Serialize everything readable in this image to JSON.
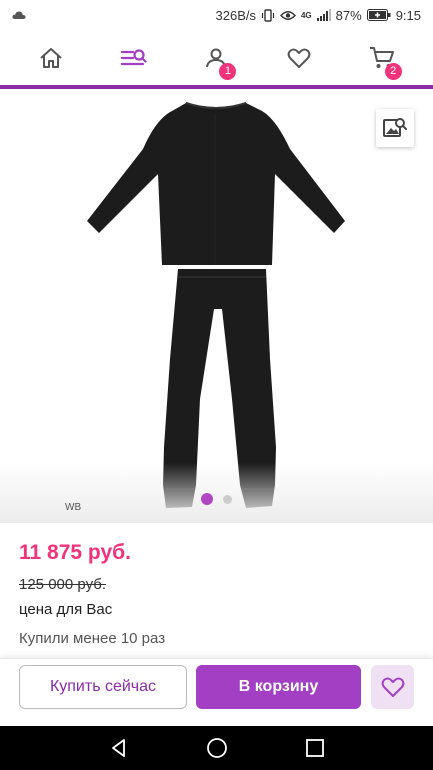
{
  "status_bar": {
    "speed": "326B/s",
    "battery": "87%",
    "time": "9:15",
    "network": "4G",
    "icons": [
      "cloud-icon",
      "vibrate-icon",
      "eye-icon",
      "signal-icon",
      "battery-icon"
    ]
  },
  "nav": {
    "items": [
      {
        "name": "home",
        "icon": "home-icon"
      },
      {
        "name": "catalog",
        "icon": "catalog-search-icon"
      },
      {
        "name": "profile",
        "icon": "user-icon",
        "badge": "1"
      },
      {
        "name": "favorites",
        "icon": "heart-icon"
      },
      {
        "name": "cart",
        "icon": "cart-icon",
        "badge": "2"
      }
    ],
    "accent_color": "#8a2ba8",
    "badge_color": "#f0337b"
  },
  "gallery": {
    "brand_tag": "WB",
    "image": "black-thermal-underwear-set",
    "photo_search_icon": "image-search-icon",
    "page_count": 2,
    "active_page": 1
  },
  "product": {
    "price": "11 875 руб.",
    "old_price": "125 000 руб.",
    "price_note": "цена для Вас",
    "bought_text": "Купили менее 10 раз"
  },
  "actions": {
    "buy_now_label": "Купить сейчас",
    "cart_label": "В корзину",
    "favorite_icon": "heart-icon"
  },
  "system_nav": [
    "back-icon",
    "home-circle-icon",
    "recents-icon"
  ]
}
